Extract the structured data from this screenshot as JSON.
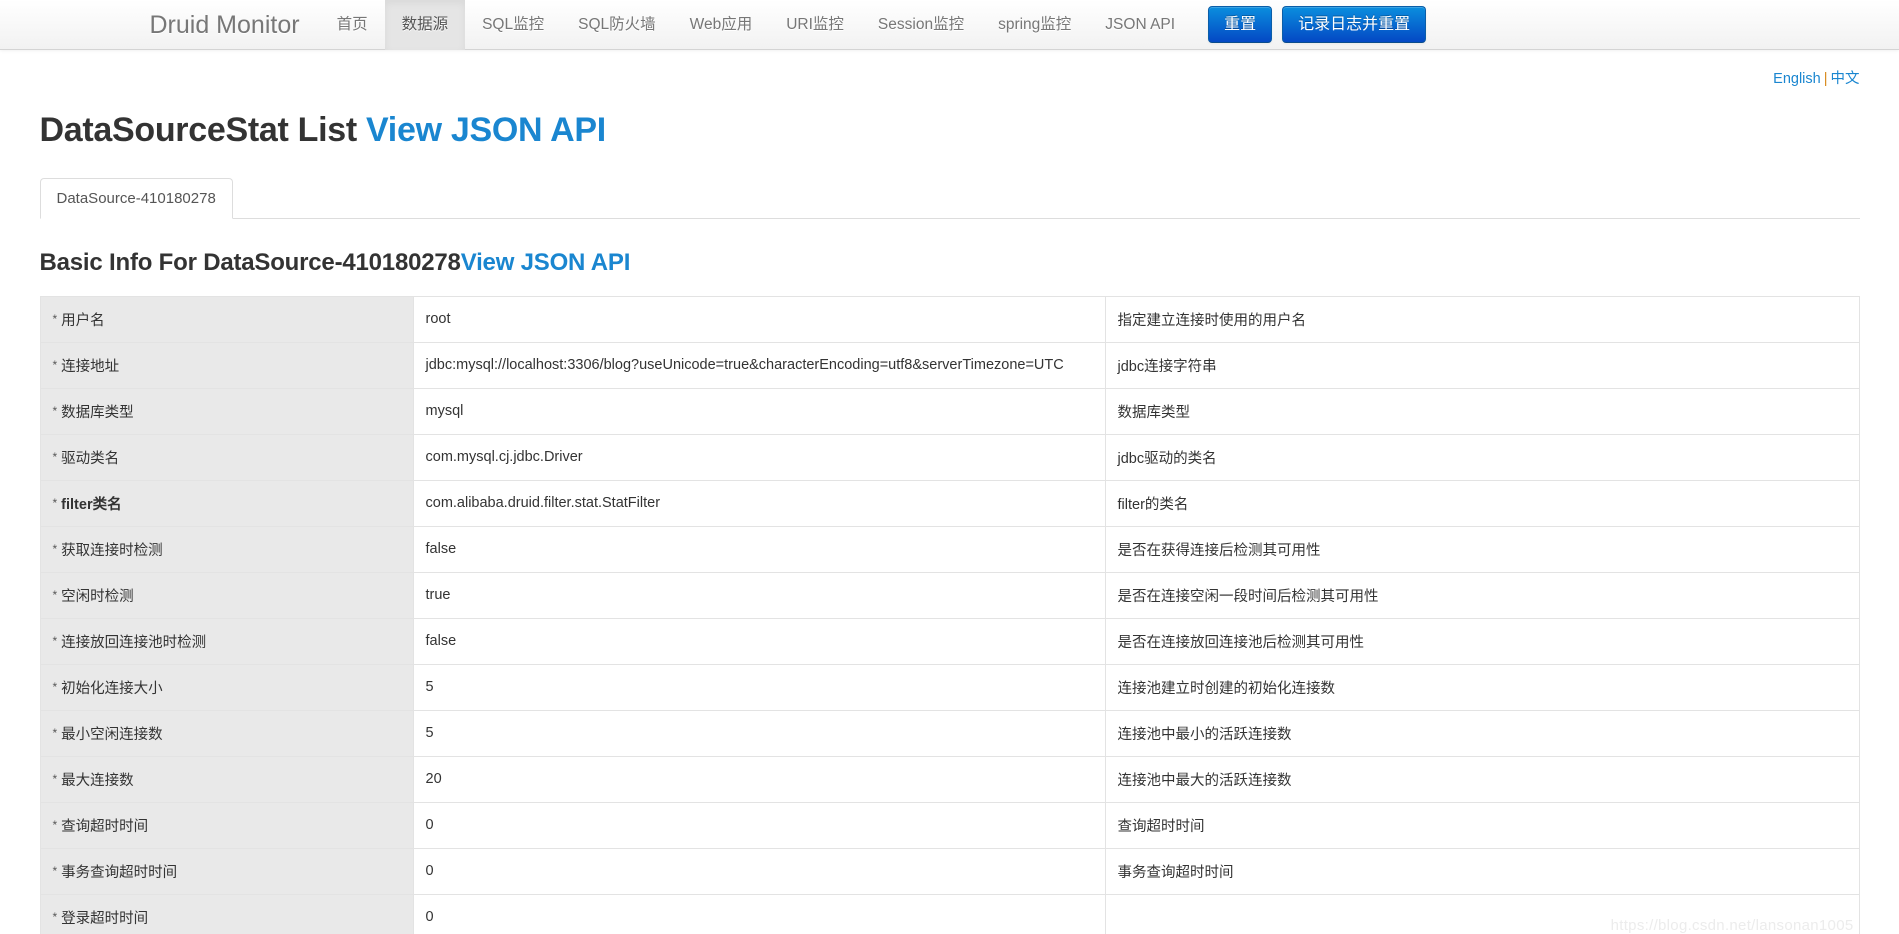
{
  "navbar": {
    "brand": "Druid Monitor",
    "items": [
      {
        "label": "首页",
        "active": false
      },
      {
        "label": "数据源",
        "active": true
      },
      {
        "label": "SQL监控",
        "active": false
      },
      {
        "label": "SQL防火墙",
        "active": false
      },
      {
        "label": "Web应用",
        "active": false
      },
      {
        "label": "URI监控",
        "active": false
      },
      {
        "label": "Session监控",
        "active": false
      },
      {
        "label": "spring监控",
        "active": false
      },
      {
        "label": "JSON API",
        "active": false
      }
    ],
    "reset_button": "重置",
    "log_and_reset_button": "记录日志并重置",
    "button_color": "#0571d3"
  },
  "lang_bar": {
    "english": "English",
    "separator": "|",
    "chinese": "中文"
  },
  "page": {
    "title": "DataSourceStat List",
    "title_link": "View JSON API",
    "link_color": "#1a86d0"
  },
  "tabs": [
    {
      "label": "DataSource-410180278",
      "active": true
    }
  ],
  "section": {
    "title": "Basic Info For DataSource-410180278",
    "title_link": "View JSON API"
  },
  "table": {
    "rows": [
      {
        "label": "用户名",
        "value": "root",
        "desc": "指定建立连接时使用的用户名",
        "bold": false
      },
      {
        "label": "连接地址",
        "value": "jdbc:mysql://localhost:3306/blog?useUnicode=true&characterEncoding=utf8&serverTimezone=UTC",
        "desc": "jdbc连接字符串",
        "bold": false
      },
      {
        "label": "数据库类型",
        "value": "mysql",
        "desc": "数据库类型",
        "bold": false
      },
      {
        "label": "驱动类名",
        "value": "com.mysql.cj.jdbc.Driver",
        "desc": "jdbc驱动的类名",
        "bold": false
      },
      {
        "label": "filter类名",
        "value": "com.alibaba.druid.filter.stat.StatFilter",
        "desc": "filter的类名",
        "bold": true
      },
      {
        "label": "获取连接时检测",
        "value": "false",
        "desc": "是否在获得连接后检测其可用性",
        "bold": false
      },
      {
        "label": "空闲时检测",
        "value": "true",
        "desc": "是否在连接空闲一段时间后检测其可用性",
        "bold": false
      },
      {
        "label": "连接放回连接池时检测",
        "value": "false",
        "desc": "是否在连接放回连接池后检测其可用性",
        "bold": false
      },
      {
        "label": "初始化连接大小",
        "value": "5",
        "desc": "连接池建立时创建的初始化连接数",
        "bold": false
      },
      {
        "label": "最小空闲连接数",
        "value": "5",
        "desc": "连接池中最小的活跃连接数",
        "bold": false
      },
      {
        "label": "最大连接数",
        "value": "20",
        "desc": "连接池中最大的活跃连接数",
        "bold": false
      },
      {
        "label": "查询超时时间",
        "value": "0",
        "desc": "查询超时时间",
        "bold": false
      },
      {
        "label": "事务查询超时时间",
        "value": "0",
        "desc": "事务查询超时时间",
        "bold": false
      },
      {
        "label": "登录超时时间",
        "value": "0",
        "desc": "",
        "bold": false
      }
    ],
    "star_marker": "*"
  },
  "watermark": "https://blog.csdn.net/lansonan1005"
}
